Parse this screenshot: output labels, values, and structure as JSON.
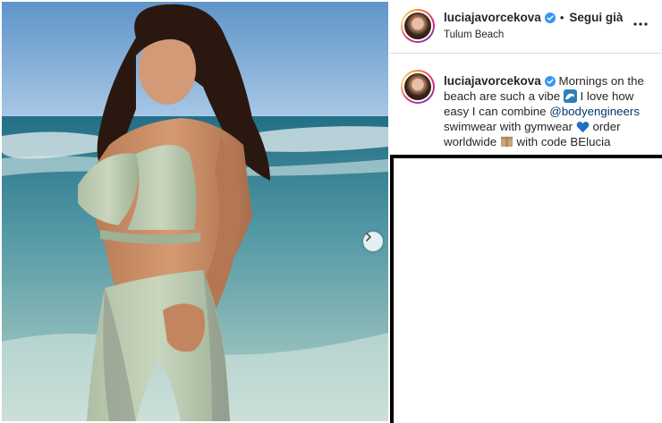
{
  "post": {
    "author": {
      "username": "luciajavorcekova",
      "verified": true,
      "follow_label": "Segui già",
      "location": "Tulum Beach"
    },
    "caption": {
      "username": "luciajavorcekova",
      "text_1": "Mornings on the beach are such a vibe",
      "text_2": "I love how easy I can combine",
      "mention": "@bodyengineers",
      "text_3": "swimwear with gymwear",
      "text_4": "order worldwide",
      "text_5": "with code BElucia"
    },
    "icons": {
      "verified": "verified-badge-icon",
      "more": "more-options-icon",
      "next": "chevron-right-icon",
      "wave": "wave-emoji",
      "heart": "blue-heart-emoji",
      "box": "package-emoji"
    },
    "colors": {
      "verified": "#3897f0",
      "mention": "#00376b",
      "text": "#262626"
    }
  }
}
